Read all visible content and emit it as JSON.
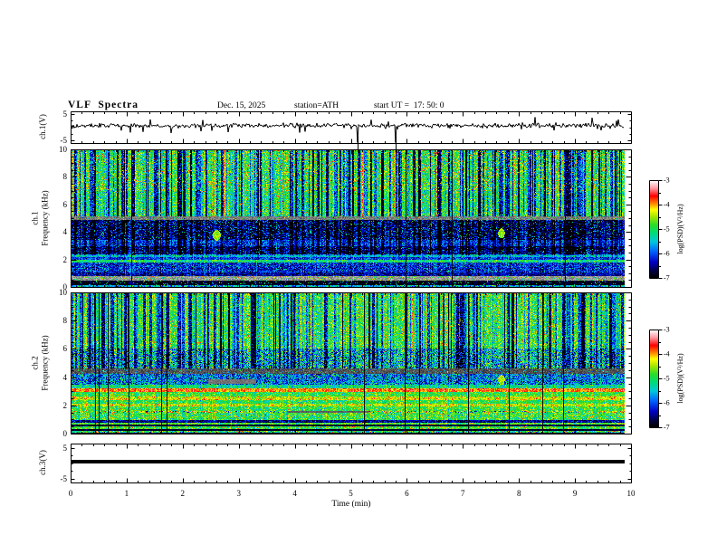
{
  "header": {
    "title": "VLF  Spectra",
    "date": "Dec. 15, 2025",
    "station": "station=ATH",
    "start_ut": "start UT =  17: 50: 0"
  },
  "time_axis": {
    "label": "Time (min)",
    "ticks": [
      "0",
      "1",
      "2",
      "3",
      "4",
      "5",
      "6",
      "7",
      "8",
      "9",
      "10"
    ],
    "minor_interval_min": 0.2,
    "range_min": [
      0,
      10
    ]
  },
  "left_axes": {
    "ch1_wave": {
      "label": "ch.1(V)",
      "ticks": [
        "5",
        "-5"
      ],
      "range_v": [
        -5,
        5
      ]
    },
    "ch1_spec": {
      "label_line1": "ch.1",
      "label_line2": "Frequency (kHz)",
      "ticks": [
        "10",
        "8",
        "6",
        "4",
        "2",
        "0"
      ],
      "range_khz": [
        0,
        10
      ]
    },
    "ch2_spec": {
      "label_line1": "ch.2",
      "label_line2": "Frequency (kHz)",
      "ticks": [
        "10",
        "8",
        "6",
        "4",
        "2",
        "0"
      ],
      "range_khz": [
        0,
        10
      ]
    },
    "ch3_wave": {
      "label": "ch.3(V)",
      "ticks": [
        "5",
        "-5"
      ],
      "range_v": [
        -5,
        5
      ]
    }
  },
  "colorbar": {
    "label": "log(PSD)(V²/Hz)",
    "ticks": [
      "-3",
      "-4",
      "-5",
      "-6",
      "-7"
    ],
    "range_logpsd": [
      -7,
      -3
    ],
    "colormap_stops": [
      [
        0,
        "#000000"
      ],
      [
        0.07,
        "#000046"
      ],
      [
        0.16,
        "#0000c8"
      ],
      [
        0.27,
        "#0064ff"
      ],
      [
        0.37,
        "#00c8dc"
      ],
      [
        0.46,
        "#00dc78"
      ],
      [
        0.54,
        "#28dc28"
      ],
      [
        0.63,
        "#aae600"
      ],
      [
        0.7,
        "#ffff00"
      ],
      [
        0.77,
        "#ff7800"
      ],
      [
        0.84,
        "#ff0000"
      ],
      [
        0.92,
        "#ff96a0"
      ],
      [
        1,
        "#ffffff"
      ]
    ]
  },
  "chart_data": [
    {
      "type": "line",
      "panel": "ch1_waveform",
      "xrange_min": [
        0,
        10
      ],
      "yrange_v": [
        -5,
        5
      ],
      "description": "Noisy broadband voltage trace, mean near +0.6 V with impulsive spikes to about ±4 V and deep dropouts near 5.1 and 5.8 min",
      "gen": {
        "seed": 101,
        "baseline_v": 0.6,
        "noise_sd_v": 0.45,
        "spike_prob": 0.055,
        "spike_v": 2.6,
        "deep_spike_min": [
          5.12,
          5.8
        ]
      }
    },
    {
      "type": "heatmap",
      "panel": "ch1_spectrogram",
      "xrange_min": [
        0,
        10
      ],
      "yrange_khz": [
        0,
        10
      ],
      "zrange_logpsd": [
        -7,
        -3
      ],
      "seed": 7,
      "bands": [
        {
          "f_khz": [
            7.0,
            10.0
          ],
          "level": -4.8,
          "noise": 0.45,
          "speckle": {
            "prob": 0.045,
            "level": -4.0
          }
        },
        {
          "f_khz": [
            5.15,
            7.0
          ],
          "level": -4.9,
          "noise": 0.4,
          "speckle": {
            "prob": 0.012,
            "level": -4.2
          }
        },
        {
          "f_khz": [
            4.9,
            5.15
          ],
          "gray": [
            120,
            70
          ],
          "speckle": {
            "prob": 0.12,
            "level": -5.2
          }
        },
        {
          "f_khz": [
            3.4,
            4.9
          ],
          "level": -6.5,
          "noise": 0.45,
          "speckle": {
            "prob": 0.05,
            "level": -5.4
          }
        },
        {
          "f_khz": [
            2.95,
            3.4
          ],
          "level": -6.0,
          "noise": 0.35
        },
        {
          "f_khz": [
            2.35,
            2.95
          ],
          "level": -6.5,
          "noise": 0.35,
          "speckle": {
            "prob": 0.04,
            "level": -5.5
          }
        },
        {
          "f_khz": [
            2.15,
            2.35
          ],
          "level": -5.5,
          "noise": 0.3
        },
        {
          "f_khz": [
            1.95,
            2.15
          ],
          "level": -6.1,
          "noise": 0.3
        },
        {
          "f_khz": [
            1.8,
            1.95
          ],
          "level": -5.1,
          "noise": 0.3
        },
        {
          "f_khz": [
            1.05,
            1.8
          ],
          "level": -6.2,
          "noise": 0.35,
          "speckle": {
            "prob": 0.05,
            "level": -5.3
          }
        },
        {
          "f_khz": [
            0.8,
            1.05
          ],
          "level": -6.45,
          "noise": 0.3
        },
        {
          "f_khz": [
            0.45,
            0.8
          ],
          "gray": [
            150,
            80
          ],
          "speckle": {
            "prob": 0.2,
            "level": -4.8
          }
        },
        {
          "f_khz": [
            0.15,
            0.45
          ],
          "level": -6.9,
          "noise": 0.15,
          "speckle": {
            "prob": 0.07,
            "level": -5.2
          }
        },
        {
          "f_khz": [
            0.0,
            0.15
          ],
          "level": -5.6,
          "noise": 0.45
        }
      ],
      "streaks": {
        "prob": 0.3,
        "depth": 1.5,
        "warm_prob": 0.05,
        "warm_boost": 0.75,
        "full_black_prob": 0.012,
        "strong_above_khz": 5.0,
        "weak_above_khz": 2.3,
        "weak_factor": 0.45
      },
      "blobs": [
        {
          "t_min": 2.6,
          "f_khz": 3.75,
          "dt_min": 0.07,
          "df_khz": 0.4,
          "level": -4.5
        },
        {
          "t_min": 7.68,
          "f_khz": 3.9,
          "dt_min": 0.06,
          "df_khz": 0.35,
          "level": -4.6
        }
      ],
      "patches": []
    },
    {
      "type": "heatmap",
      "panel": "ch2_spectrogram",
      "xrange_min": [
        0,
        10
      ],
      "yrange_khz": [
        0,
        10
      ],
      "zrange_logpsd": [
        -7,
        -3
      ],
      "seed": 13,
      "bands": [
        {
          "f_khz": [
            6.0,
            10.0
          ],
          "level": -4.85,
          "noise": 0.4,
          "speckle": {
            "prob": 0.012,
            "level": -4.1
          }
        },
        {
          "f_khz": [
            4.6,
            6.0
          ],
          "level": -5.3,
          "noise": 0.6,
          "speckle": {
            "prob": 0.1,
            "level": -6.2
          }
        },
        {
          "f_khz": [
            4.2,
            4.6
          ],
          "gray": [
            80,
            60
          ],
          "speckle": {
            "prob": 0.12,
            "level": -5.5
          }
        },
        {
          "f_khz": [
            3.45,
            4.2
          ],
          "level": -5.9,
          "noise": 0.45,
          "speckle": {
            "prob": 0.07,
            "level": -5.0
          }
        },
        {
          "f_khz": [
            3.2,
            3.45
          ],
          "level": -5.2,
          "noise": 0.3
        },
        {
          "f_khz": [
            2.95,
            3.2
          ],
          "level": -3.9,
          "noise": 0.2
        },
        {
          "f_khz": [
            2.6,
            2.95
          ],
          "level": -4.9,
          "noise": 0.3
        },
        {
          "f_khz": [
            2.4,
            2.6
          ],
          "level": -4.35,
          "noise": 0.3,
          "speckle": {
            "prob": 0.06,
            "level": -3.9
          }
        },
        {
          "f_khz": [
            2.1,
            2.4
          ],
          "level": -4.95,
          "noise": 0.3
        },
        {
          "f_khz": [
            1.9,
            2.1
          ],
          "level": -4.4,
          "noise": 0.3,
          "speckle": {
            "prob": 0.05,
            "level": -4.0
          }
        },
        {
          "f_khz": [
            1.63,
            1.9
          ],
          "level": -4.9,
          "noise": 0.35
        },
        {
          "f_khz": [
            1.45,
            1.63
          ],
          "level": -4.6,
          "noise": 0.5,
          "speckle": {
            "prob": 0.08,
            "level": -6.3
          }
        },
        {
          "f_khz": [
            0.95,
            1.45
          ],
          "level": -4.9,
          "noise": 0.4
        },
        {
          "f_khz": [
            0.8,
            0.95
          ],
          "level": -6.5,
          "noise": 0.3
        },
        {
          "f_khz": [
            0.62,
            0.8
          ],
          "level": -4.8,
          "noise": 0.35
        },
        {
          "f_khz": [
            0.5,
            0.62
          ],
          "level": -6.85,
          "noise": 0.15
        },
        {
          "f_khz": [
            0.35,
            0.5
          ],
          "level": -4.9,
          "noise": 0.35,
          "speckle": {
            "prob": 0.05,
            "level": -4.0
          }
        },
        {
          "f_khz": [
            0.2,
            0.35
          ],
          "level": -6.9,
          "noise": 0.12
        },
        {
          "f_khz": [
            0.07,
            0.2
          ],
          "level": -5.2,
          "noise": 0.45,
          "speckle": {
            "prob": 0.08,
            "level": -4.0
          }
        },
        {
          "f_khz": [
            0.0,
            0.07
          ],
          "level": -6.9,
          "noise": 0.1
        }
      ],
      "streaks": {
        "prob": 0.25,
        "depth": 1.4,
        "warm_prob": 0.05,
        "warm_boost": 0.6,
        "full_black_prob": 0.015,
        "strong_above_khz": 4.6,
        "weak_above_khz": 4.2,
        "weak_factor": 0.3
      },
      "blobs": [
        {
          "t_min": 7.68,
          "f_khz": 3.8,
          "dt_min": 0.06,
          "df_khz": 0.35,
          "level": -4.5
        }
      ],
      "patches": [
        {
          "t_min": [
            2.45,
            3.3
          ],
          "f_khz": [
            3.55,
            3.85
          ],
          "gray": [
            115,
            40
          ]
        },
        {
          "t_min": [
            3.85,
            5.3
          ],
          "f_khz": [
            1.45,
            1.63
          ],
          "gray": [
            95,
            40
          ]
        }
      ]
    },
    {
      "type": "line",
      "panel": "ch3_waveform",
      "xrange_min": [
        0,
        10
      ],
      "yrange_v": [
        -5,
        5
      ],
      "value_v": 0,
      "description": "Constant flat thick black line at 0 V for the whole record"
    }
  ]
}
